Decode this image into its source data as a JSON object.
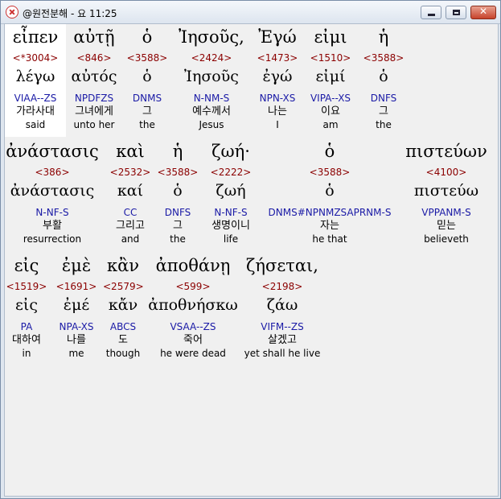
{
  "window": {
    "title": "@원전분해 - 요 11:25",
    "minimize_icon": "minimize-icon",
    "maximize_icon": "maximize-icon",
    "close_icon": "close-icon",
    "close_glyph": "✕"
  },
  "rows": [
    [
      {
        "greek": "εἶπεν",
        "strong": "<*3004>",
        "lemma": "λέγω",
        "morph": "VIAA--ZS",
        "korean": "가라사대",
        "english": "said"
      },
      {
        "greek": "αὐτῇ",
        "strong": "<846>",
        "lemma": "αὐτός",
        "morph": "NPDFZS",
        "korean": "그녀에게",
        "english": "unto her"
      },
      {
        "greek": "ὁ",
        "strong": "<3588>",
        "lemma": "ὁ",
        "morph": "DNMS",
        "korean": "그",
        "english": "the"
      },
      {
        "greek": "Ἰησοῦς,",
        "strong": "<2424>",
        "lemma": "Ἰησοῦς",
        "morph": "N-NM-S",
        "korean": "예수께서",
        "english": "Jesus"
      },
      {
        "greek": "Ἐγώ",
        "strong": "<1473>",
        "lemma": "ἐγώ",
        "morph": "NPN-XS",
        "korean": "나는",
        "english": "I"
      },
      {
        "greek": "εἰμι",
        "strong": "<1510>",
        "lemma": "εἰμί",
        "morph": "VIPA--XS",
        "korean": "이요",
        "english": "am"
      },
      {
        "greek": "ἡ",
        "strong": "<3588>",
        "lemma": "ὁ",
        "morph": "DNFS",
        "korean": "그",
        "english": "the"
      }
    ],
    [
      {
        "greek": "ἀνάστασις",
        "strong": "<386>",
        "lemma": "ἀνάστασις",
        "morph": "N-NF-S",
        "korean": "부활",
        "english": "resurrection"
      },
      {
        "greek": "καὶ",
        "strong": "<2532>",
        "lemma": "καί",
        "morph": "CC",
        "korean": "그리고",
        "english": "and"
      },
      {
        "greek": "ἡ",
        "strong": "<3588>",
        "lemma": "ὁ",
        "morph": "DNFS",
        "korean": "그",
        "english": "the"
      },
      {
        "greek": "ζωή·",
        "strong": "<2222>",
        "lemma": "ζωή",
        "morph": "N-NF-S",
        "korean": "생명이니",
        "english": "life"
      },
      {
        "greek": "ὁ",
        "strong": "<3588>",
        "lemma": "ὁ",
        "morph": "DNMS#NPNMZSAPRNM-S",
        "korean": "자는",
        "english": "he that"
      },
      {
        "greek": "πιστεύων",
        "strong": "<4100>",
        "lemma": "πιστεύω",
        "morph": "VPPANM-S",
        "korean": "믿는",
        "english": "believeth"
      }
    ],
    [
      {
        "greek": "εἰς",
        "strong": "<1519>",
        "lemma": "εἰς",
        "morph": "PA",
        "korean": "대하여",
        "english": "in"
      },
      {
        "greek": "ἐμὲ",
        "strong": "<1691>",
        "lemma": "ἐμέ",
        "morph": "NPA-XS",
        "korean": "나를",
        "english": "me"
      },
      {
        "greek": "κἂν",
        "strong": "<2579>",
        "lemma": "κἄν",
        "morph": "ABCS",
        "korean": "도",
        "english": "though"
      },
      {
        "greek": "ἀποθάνῃ",
        "strong": "<599>",
        "lemma": "ἀποθνήσκω",
        "morph": "VSAA--ZS",
        "korean": "죽어",
        "english": "he were dead"
      },
      {
        "greek": "ζήσεται,",
        "strong": "<2198>",
        "lemma": "ζάω",
        "morph": "VIFM--ZS",
        "korean": "살겠고",
        "english": "yet shall he live"
      }
    ]
  ]
}
